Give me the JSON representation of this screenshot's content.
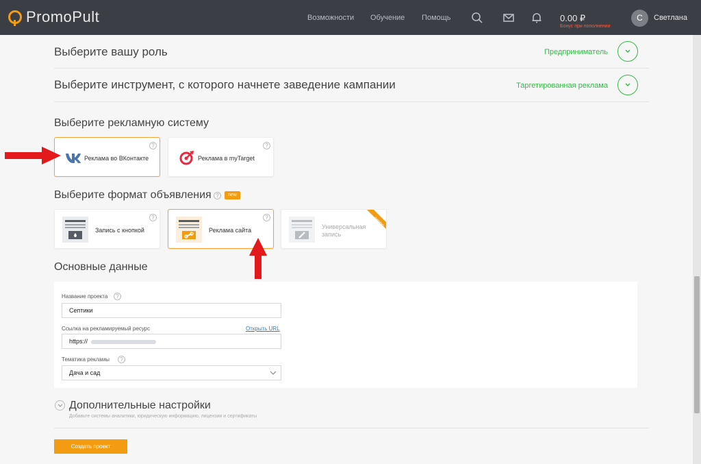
{
  "header": {
    "logo_text": "PromoPult",
    "nav": [
      "Возможности",
      "Обучение",
      "Помощь"
    ],
    "balance": "0.00 ₽",
    "bonus_text": "Бонус при пополнении",
    "avatar_letter": "С",
    "username": "Светлана",
    "icons": [
      "search-icon",
      "mail-icon",
      "bell-icon"
    ]
  },
  "steps": {
    "role": {
      "title": "Выберите вашу роль",
      "value": "Предприниматель"
    },
    "tool": {
      "title": "Выберите инструмент, с которого начнете заведение кампании",
      "value": "Таргетированная реклама"
    }
  },
  "ad_system": {
    "title": "Выберите рекламную систему",
    "options": [
      {
        "label": "Реклама во ВКонтакте",
        "icon": "vk-icon",
        "selected": true
      },
      {
        "label": "Реклама в myTarget",
        "icon": "mytarget-icon",
        "selected": false
      }
    ]
  },
  "ad_format": {
    "title": "Выберите формат объявления",
    "badge": "new",
    "options": [
      {
        "label": "Запись с кнопкой",
        "icon": "post-button-icon",
        "selected": false
      },
      {
        "label": "Реклама сайта",
        "icon": "site-ad-icon",
        "selected": true
      },
      {
        "label": "Универсальная запись",
        "icon": "universal-post-icon",
        "selected": false,
        "ribbon": "скоро"
      }
    ]
  },
  "basic": {
    "title": "Основные данные",
    "project_name_label": "Название проекта",
    "project_name_value": "Септики",
    "url_label": "Ссылка на рекламируемый ресурс",
    "open_url_link": "Открыть URL",
    "url_value": "https://",
    "topic_label": "Тематика рекламы",
    "topic_value": "Дача и сад"
  },
  "advanced": {
    "title": "Дополнительные настройки",
    "subtitle": "Добавьте системы аналитики, юридическую информацию, лицензии и сертификаты"
  },
  "create_button": "Создать проект",
  "colors": {
    "accent": "#f39c12",
    "green": "#37b74a",
    "header": "#3b3e44",
    "arrow": "#e3191c"
  }
}
